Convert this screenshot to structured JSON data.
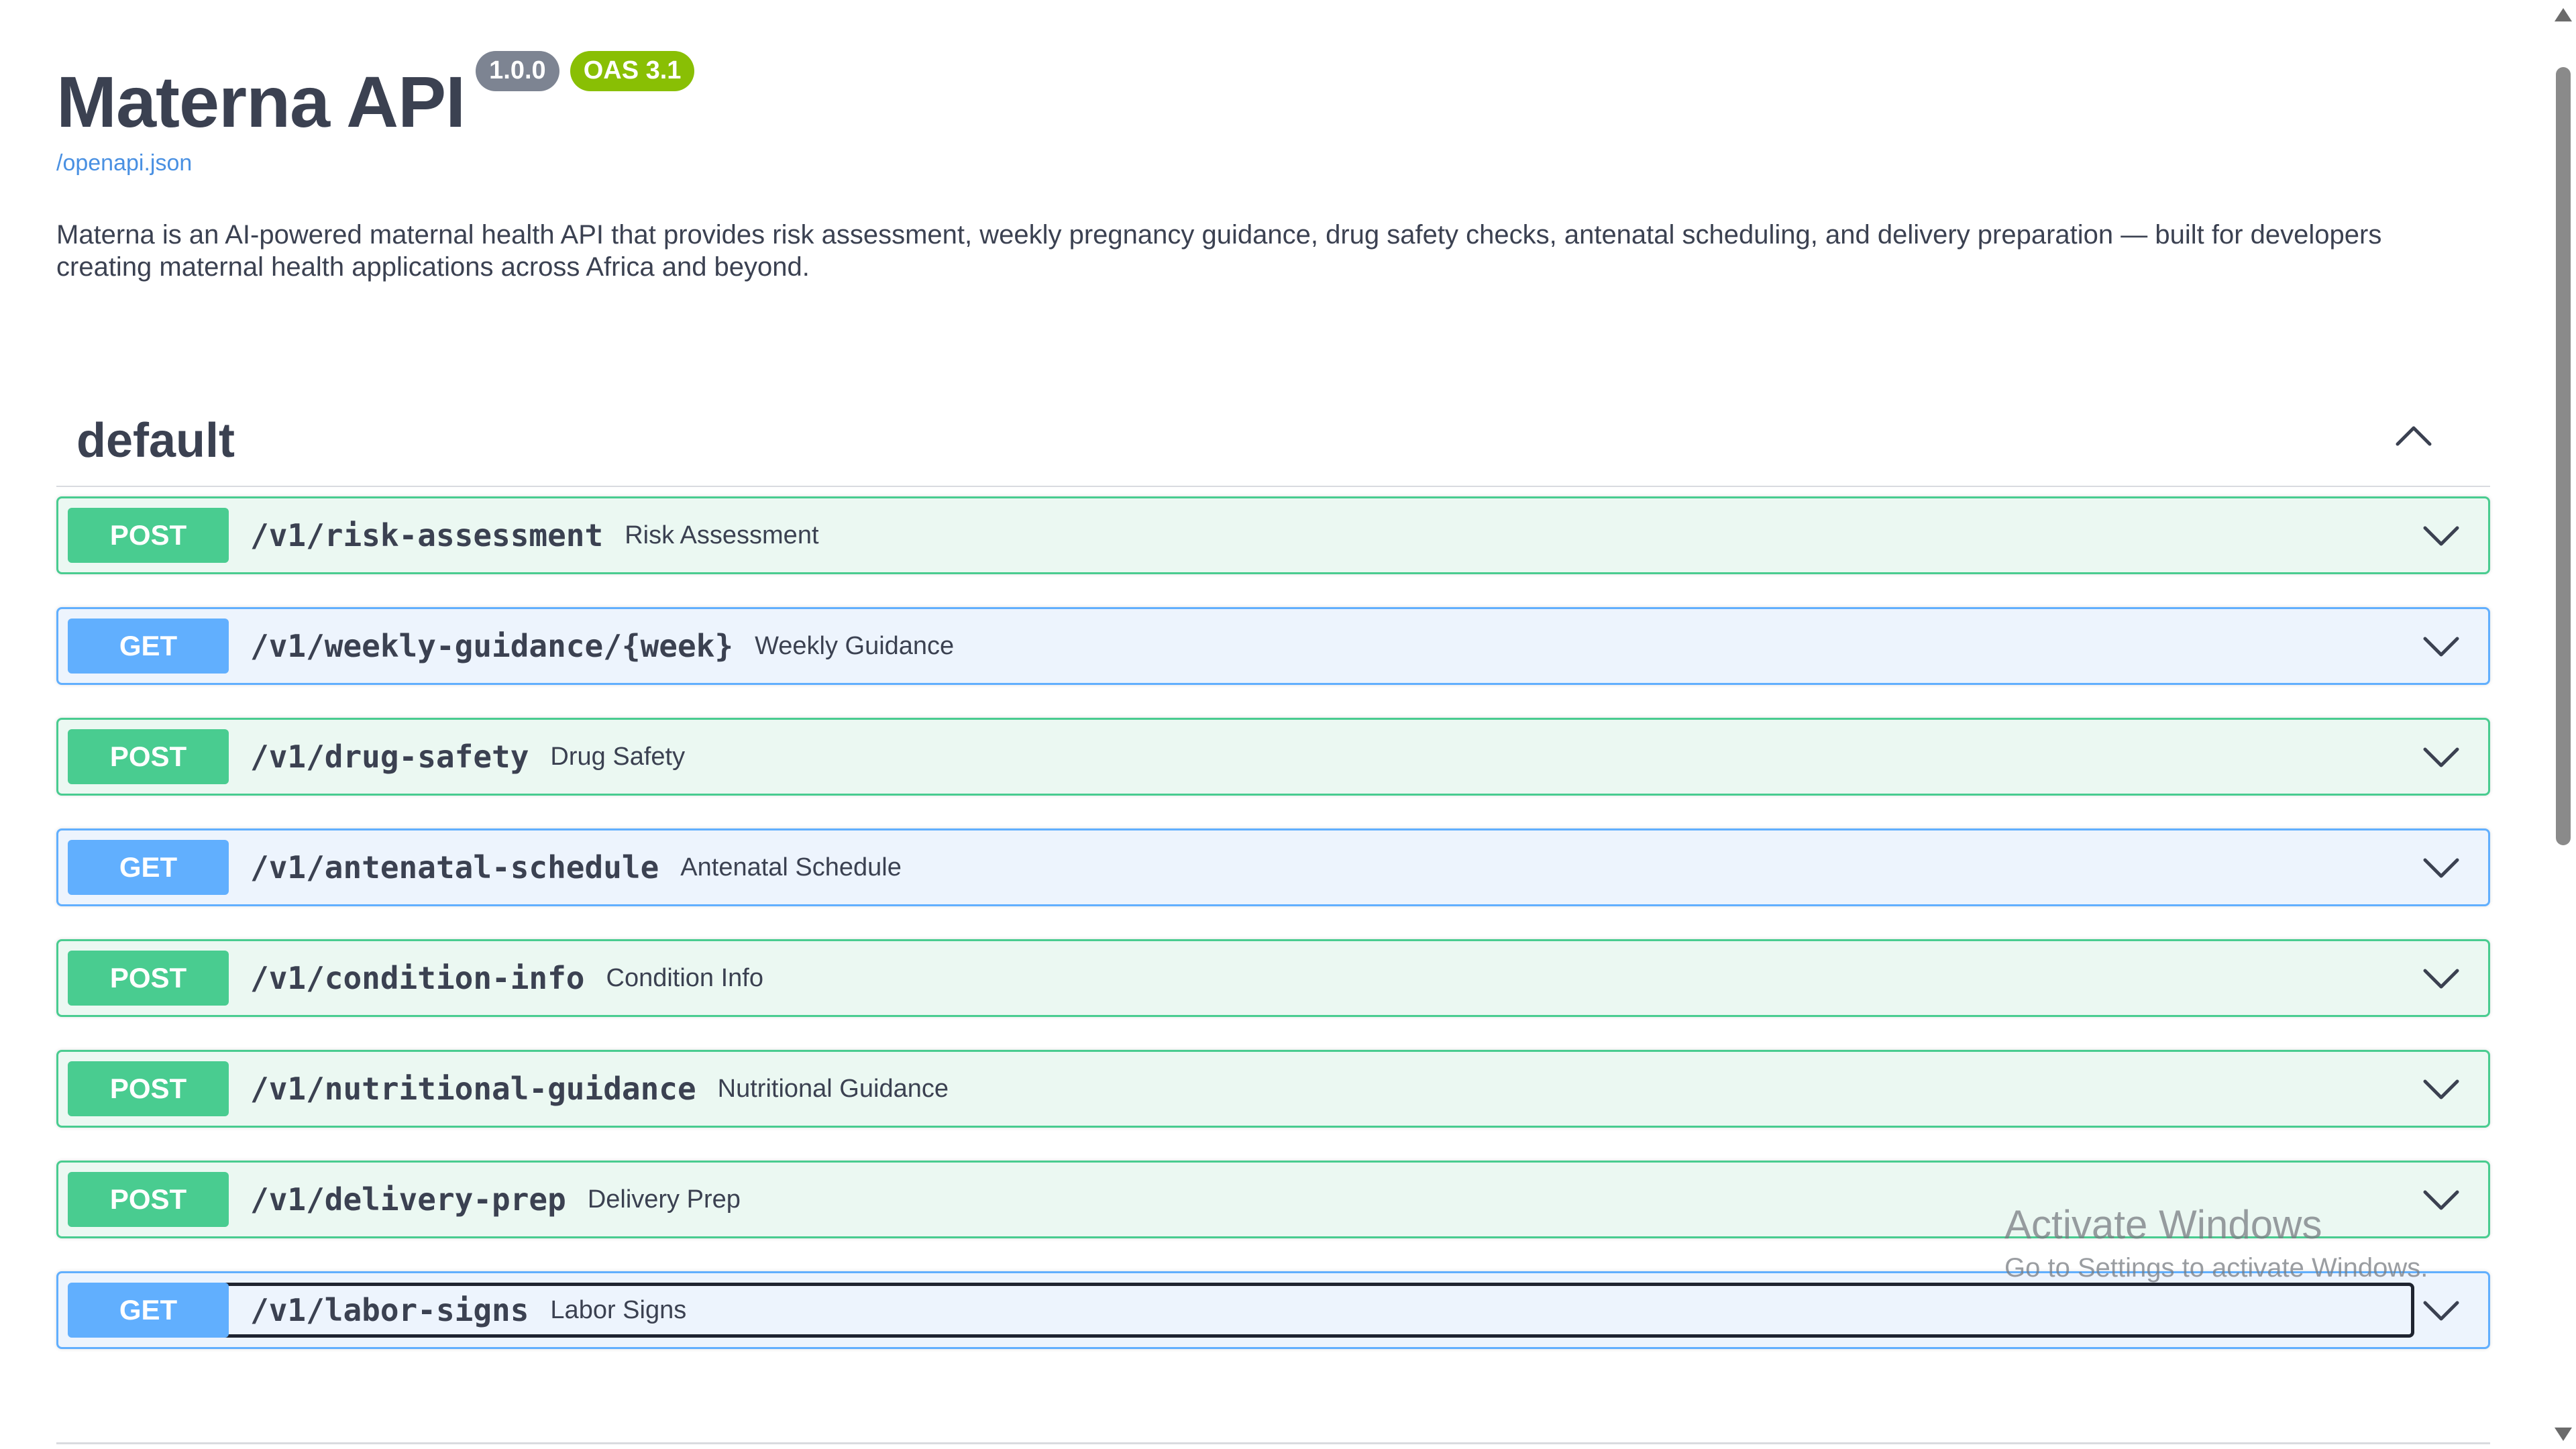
{
  "header": {
    "title": "Materna API",
    "version_badge": "1.0.0",
    "oas_badge": "OAS 3.1",
    "spec_link": "/openapi.json"
  },
  "description": "Materna is an AI-powered maternal health API that provides risk assessment, weekly pregnancy guidance, drug safety checks, antenatal scheduling, and delivery preparation — built for developers creating maternal health applications across Africa and beyond.",
  "section": {
    "title": "default",
    "toggle_icon": "chevron-up-icon"
  },
  "operations": [
    {
      "method": "POST",
      "path": "/v1/risk-assessment",
      "summary": "Risk Assessment"
    },
    {
      "method": "GET",
      "path": "/v1/weekly-guidance/{week}",
      "summary": "Weekly Guidance"
    },
    {
      "method": "POST",
      "path": "/v1/drug-safety",
      "summary": "Drug Safety"
    },
    {
      "method": "GET",
      "path": "/v1/antenatal-schedule",
      "summary": "Antenatal Schedule"
    },
    {
      "method": "POST",
      "path": "/v1/condition-info",
      "summary": "Condition Info"
    },
    {
      "method": "POST",
      "path": "/v1/nutritional-guidance",
      "summary": "Nutritional Guidance"
    },
    {
      "method": "POST",
      "path": "/v1/delivery-prep",
      "summary": "Delivery Prep"
    },
    {
      "method": "GET",
      "path": "/v1/labor-signs",
      "summary": "Labor Signs"
    }
  ],
  "watermark": {
    "line1": "Activate Windows",
    "line2": "Go to Settings to activate Windows."
  },
  "colors": {
    "post": "#49cc90",
    "get": "#61affe",
    "text": "#3b4151",
    "link": "#4990e2"
  }
}
